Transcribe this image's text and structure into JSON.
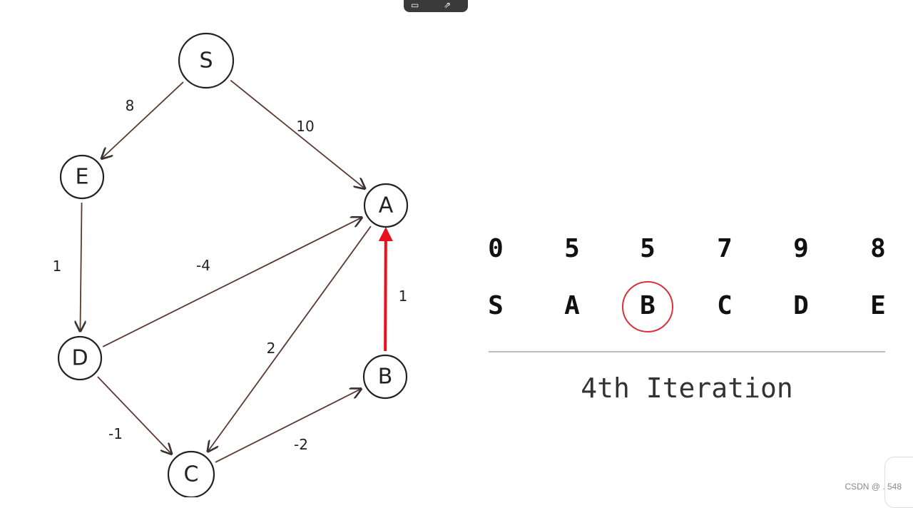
{
  "graph": {
    "nodes": [
      {
        "id": "S",
        "label": "S"
      },
      {
        "id": "E",
        "label": "E"
      },
      {
        "id": "A",
        "label": "A"
      },
      {
        "id": "D",
        "label": "D"
      },
      {
        "id": "B",
        "label": "B"
      },
      {
        "id": "C",
        "label": "C"
      }
    ],
    "edges": [
      {
        "from": "S",
        "to": "E",
        "weight": "8"
      },
      {
        "from": "S",
        "to": "A",
        "weight": "10"
      },
      {
        "from": "E",
        "to": "D",
        "weight": "1"
      },
      {
        "from": "D",
        "to": "A",
        "weight": "-4"
      },
      {
        "from": "A",
        "to": "C",
        "weight": "2"
      },
      {
        "from": "D",
        "to": "C",
        "weight": "-1"
      },
      {
        "from": "C",
        "to": "B",
        "weight": "-2"
      },
      {
        "from": "B",
        "to": "A",
        "weight": "1",
        "highlighted": true
      }
    ],
    "highlight_color": "#e8101c"
  },
  "distances": {
    "values": [
      "0",
      "5",
      "5",
      "7",
      "9",
      "8"
    ],
    "labels": [
      "S",
      "A",
      "B",
      "C",
      "D",
      "E"
    ],
    "current_node": "B",
    "current_color": "#d8323c"
  },
  "caption": "4th Iteration",
  "watermark": "CSDN @ . 548"
}
